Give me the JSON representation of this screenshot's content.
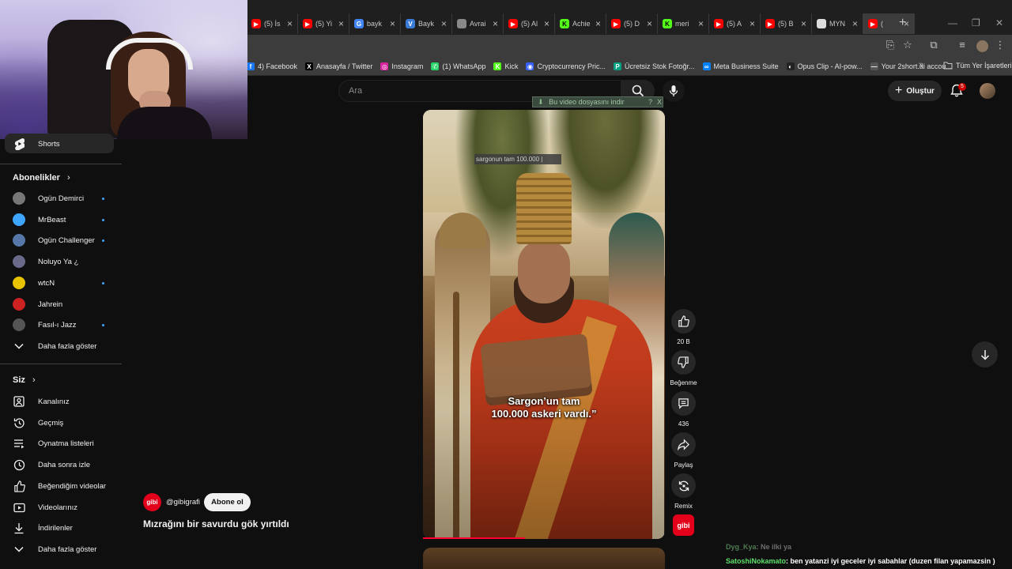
{
  "browser": {
    "tabs": [
      {
        "title": "(5) İs",
        "icon": "youtube",
        "color": "#ff0000"
      },
      {
        "title": "(5) Yi",
        "icon": "youtube",
        "color": "#ff0000"
      },
      {
        "title": "bayk",
        "icon": "google",
        "color": "#4285f4"
      },
      {
        "title": "Bayk",
        "icon": "v-logo",
        "color": "#3a7bd5"
      },
      {
        "title": "Avrai",
        "icon": "globe",
        "color": "#888888"
      },
      {
        "title": "(5) Al",
        "icon": "youtube",
        "color": "#ff0000"
      },
      {
        "title": "Achie",
        "icon": "kick",
        "color": "#53fc18"
      },
      {
        "title": "(5) D",
        "icon": "youtube",
        "color": "#ff0000"
      },
      {
        "title": "meri",
        "icon": "kick",
        "color": "#53fc18"
      },
      {
        "title": "(5) A",
        "icon": "youtube",
        "color": "#ff0000"
      },
      {
        "title": "(5) B",
        "icon": "youtube",
        "color": "#ff0000"
      },
      {
        "title": "MYN",
        "icon": "doc",
        "color": "#dddddd"
      },
      {
        "title": "(",
        "icon": "youtube",
        "color": "#ff0000"
      }
    ],
    "bookmarks": [
      {
        "label": "4) Facebook",
        "icon": "facebook",
        "color": "#1877f2"
      },
      {
        "label": "Anasayfa / Twitter",
        "icon": "x",
        "color": "#000000"
      },
      {
        "label": "Instagram",
        "icon": "instagram",
        "color": "#d6249f"
      },
      {
        "label": "(1) WhatsApp",
        "icon": "whatsapp",
        "color": "#25d366"
      },
      {
        "label": "Kick",
        "icon": "kick",
        "color": "#53fc18"
      },
      {
        "label": "Cryptocurrency Pric...",
        "icon": "crypto",
        "color": "#3861fb"
      },
      {
        "label": "Ücretsiz Stok Fotoğr...",
        "icon": "pexels",
        "color": "#05a081"
      },
      {
        "label": "Meta Business Suite",
        "icon": "meta",
        "color": "#0081fb"
      },
      {
        "label": "Opus Clip - AI-pow...",
        "icon": "opus",
        "color": "#222222"
      },
      {
        "label": "Your 2short.ai accou...",
        "icon": "dash",
        "color": "#555555"
      }
    ],
    "all_bookmarks": "Tüm Yer İşaretleri"
  },
  "header": {
    "search_placeholder": "Ara",
    "create_label": "Oluştur",
    "notification_count": "5"
  },
  "sidebar": {
    "shorts_label": "Shorts",
    "subscriptions_title": "Abonelikler",
    "channels": [
      {
        "name": "Ogün Demirci",
        "dot": true,
        "color": "#777777"
      },
      {
        "name": "MrBeast",
        "dot": true,
        "color": "#3ea6ff"
      },
      {
        "name": "Ogün Challenger",
        "dot": true,
        "color": "#5577aa"
      },
      {
        "name": "Noluyo Ya ¿",
        "dot": false,
        "color": "#6a6a8a"
      },
      {
        "name": "wtcN",
        "dot": true,
        "color": "#e8c400"
      },
      {
        "name": "Jahrein",
        "dot": false,
        "color": "#cc2222"
      },
      {
        "name": "Fasıl-ı Jazz",
        "dot": true,
        "color": "#555555"
      }
    ],
    "show_more_subs": "Daha fazla göster",
    "you_title": "Siz",
    "you_items": [
      {
        "label": "Kanalınız",
        "icon": "channel-icon"
      },
      {
        "label": "Geçmiş",
        "icon": "history-icon"
      },
      {
        "label": "Oynatma listeleri",
        "icon": "playlist-icon"
      },
      {
        "label": "Daha sonra izle",
        "icon": "clock-icon"
      },
      {
        "label": "Beğendiğim videolar",
        "icon": "like-icon"
      },
      {
        "label": "Videolarınız",
        "icon": "video-icon"
      },
      {
        "label": "İndirilenler",
        "icon": "download-icon"
      },
      {
        "label": "Daha fazla göster",
        "icon": "chevron-down-icon"
      }
    ]
  },
  "short": {
    "caption_line1": "Sargon’un tam",
    "caption_line2": "100.000 askeri vardı.”",
    "overlay_text": "sargonun tam 100.000 |",
    "download_bar": "Bu video dosyasını indir",
    "download_help": "?",
    "download_close": "X",
    "progress": 0.42,
    "actions": {
      "like_count": "20 B",
      "dislike_label": "Beğenme",
      "comment_count": "436",
      "share_label": "Paylaş",
      "remix_label": "Remix"
    },
    "channel_logo_text": "gibi",
    "channel_handle": "@gibigrafi",
    "subscribe_label": "Abone ol",
    "title": "Mızrağını bir savurdu gök yırtıldı"
  },
  "chat": [
    {
      "user": "Dyg_Kya",
      "message": ": Ne ilki ya"
    },
    {
      "user": "SatoshiNokamato",
      "message": ": ben yatanzi iyi geceler iyi sabahlar (duzen filan yapamazsin )"
    }
  ]
}
